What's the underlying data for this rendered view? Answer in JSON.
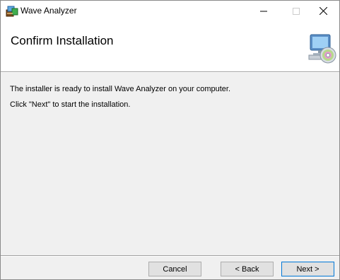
{
  "window": {
    "title": "Wave Analyzer",
    "controls": {
      "minimize_icon": "minimize-icon",
      "maximize_icon": "maximize-icon",
      "close_icon": "close-icon"
    }
  },
  "header": {
    "title": "Confirm Installation",
    "icon": "setup-computer-disc-icon"
  },
  "body": {
    "line1": "The installer is ready to install Wave Analyzer on your computer.",
    "line2": "Click \"Next\" to start the installation."
  },
  "buttons": {
    "cancel_label": "Cancel",
    "back_label": "< Back",
    "next_label": "Next >"
  },
  "colors": {
    "dialog_background": "#f0f0f0",
    "header_background": "#ffffff",
    "default_button_border": "#0078d7"
  }
}
